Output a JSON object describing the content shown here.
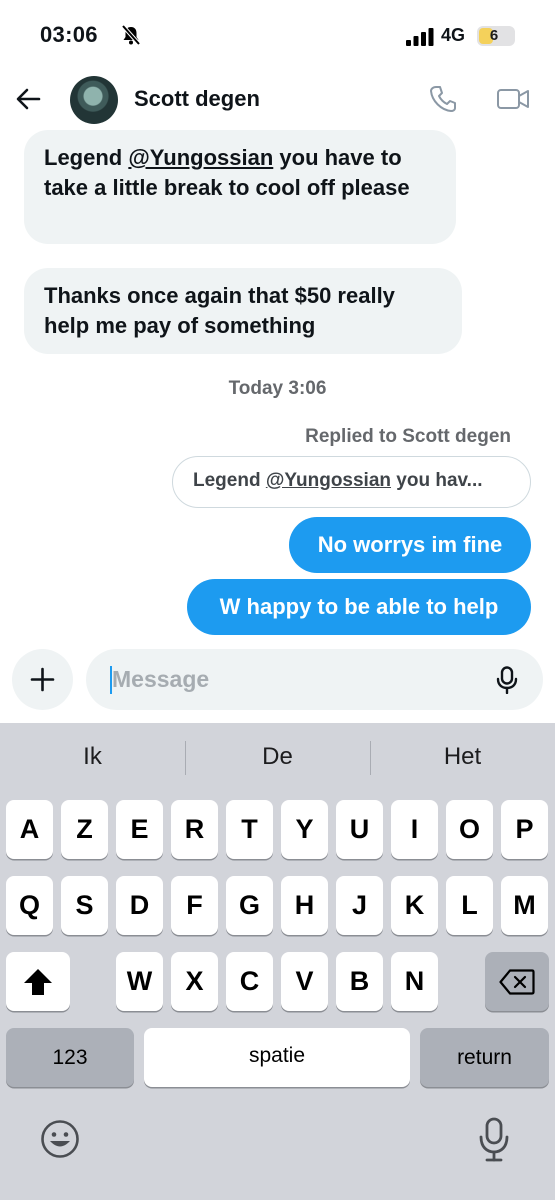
{
  "status_bar": {
    "time": "03:06",
    "network": "4G",
    "battery_level": "6",
    "battery_color": "#f4d15b"
  },
  "header": {
    "contact_name": "Scott degen",
    "icons": [
      "back-arrow-icon",
      "avatar",
      "phone-icon",
      "video-icon"
    ]
  },
  "conversation": {
    "messages": [
      {
        "direction": "incoming",
        "prefix": "Legend ",
        "mention": "@Yungossian",
        "text": " you  have to take a little break to cool off please"
      },
      {
        "direction": "incoming",
        "text": "Thanks once again that $50 really help me pay of something"
      }
    ],
    "timestamp": "Today 3:06",
    "reply_context": {
      "label": "Replied to Scott degen",
      "quote_prefix": "Legend ",
      "quote_mention": "@Yungossian",
      "quote_suffix": " you  hav..."
    },
    "outgoing": [
      {
        "text": "No worrys im fine"
      },
      {
        "text": "W happy to be able to help"
      }
    ],
    "accent_color": "#1d9bf0"
  },
  "composer": {
    "placeholder": "Message",
    "value": ""
  },
  "keyboard": {
    "suggestions": [
      "Ik",
      "De",
      "Het"
    ],
    "rows": [
      [
        "A",
        "Z",
        "E",
        "R",
        "T",
        "Y",
        "U",
        "I",
        "O",
        "P"
      ],
      [
        "Q",
        "S",
        "D",
        "F",
        "G",
        "H",
        "J",
        "K",
        "L",
        "M"
      ],
      [
        "W",
        "X",
        "C",
        "V",
        "B",
        "N"
      ]
    ],
    "numbers_key": "123",
    "space_key": "spatie",
    "return_key": "return"
  }
}
